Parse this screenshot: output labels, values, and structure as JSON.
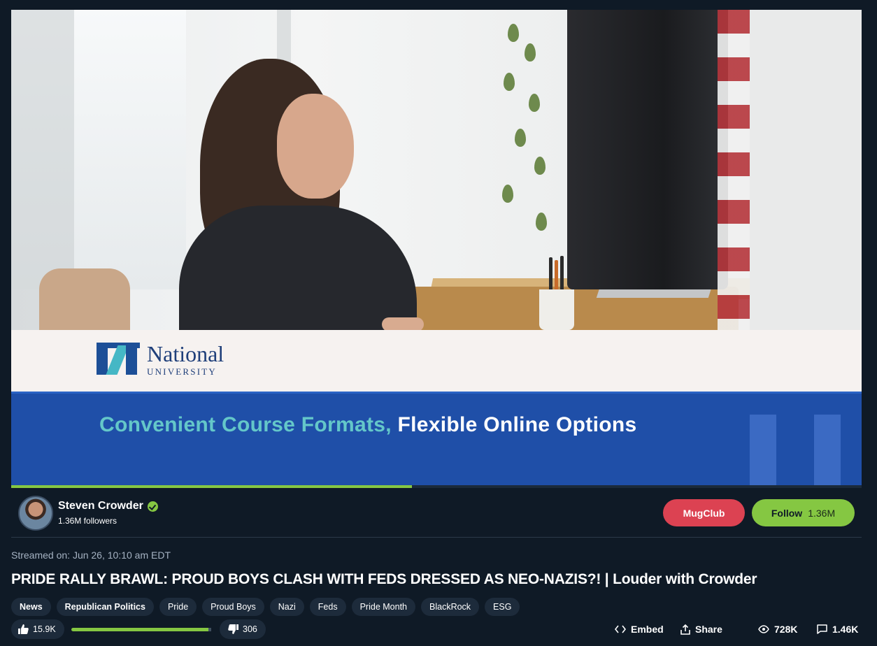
{
  "video": {
    "ad_logo_name": "National",
    "ad_logo_sub": "UNIVERSITY",
    "ad_text_highlight": "Convenient Course Formats,",
    "ad_text_rest": "Flexible Online Options",
    "progress_fraction": 0.471
  },
  "channel": {
    "name": "Steven Crowder",
    "followers": "1.36M followers",
    "verified": true,
    "mugclub_label": "MugClub",
    "follow_label": "Follow",
    "follow_count": "1.36M"
  },
  "meta": {
    "streamed": "Streamed on: Jun 26, 10:10 am EDT",
    "title": "PRIDE RALLY BRAWL: PROUD BOYS CLASH WITH FEDS DRESSED AS NEO-NAZIS?! | Louder with Crowder",
    "tags": [
      "News",
      "Republican Politics",
      "Pride",
      "Proud Boys",
      "Nazi",
      "Feds",
      "Pride Month",
      "BlackRock",
      "ESG"
    ]
  },
  "actions": {
    "likes": "15.9K",
    "dislikes": "306",
    "like_fraction": 0.98,
    "embed_label": "Embed",
    "share_label": "Share",
    "views": "728K",
    "comments": "1.46K"
  },
  "colors": {
    "background": "#0f1a26",
    "accent_green": "#85c742",
    "mugclub_red": "#dc4252",
    "tag_bg": "#1d2b3b",
    "ad_blue": "#1f4fa8",
    "ad_teal": "#64c7c9"
  }
}
